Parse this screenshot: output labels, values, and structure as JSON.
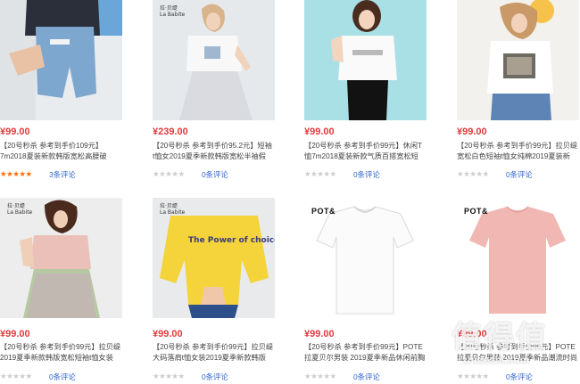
{
  "products": [
    {
      "price": "¥99.00",
      "title1": "【20号秒杀 参考到手价109元】",
      "title2": "7m2018夏装新款韩版宽松高腰破",
      "reviews": "3条评论",
      "stars": 5
    },
    {
      "price": "¥239.00",
      "title1": "【20号秒杀 参考到手价95.2元】短袖",
      "title2": "t恤女2019夏季新款韩版宽松半袖假",
      "reviews": "0条评论",
      "stars": 0
    },
    {
      "price": "¥99.00",
      "title1": "【20号秒杀 参考到手价99元】休闲T",
      "title2": "恤7m2018夏装新款气质百搭宽松短",
      "reviews": "0条评论",
      "stars": 0
    },
    {
      "price": "¥99.00",
      "title1": "【20号秒杀 参考到手价99元】拉贝缇",
      "title2": "宽松白色短袖t恤女纯棉2019夏装新",
      "reviews": "0条评论",
      "stars": 0
    },
    {
      "price": "¥99.00",
      "title1": "【20号秒杀 参考到手价99元】拉贝缇",
      "title2": "2019夏季新款韩版宽松短袖t恤女装",
      "reviews": "0条评论",
      "stars": 0
    },
    {
      "price": "¥99.00",
      "title1": "【20号秒杀 参考到手价99元】拉贝缇",
      "title2": "大码落肩t恤女装2019夏季新款韩版",
      "reviews": "0条评论",
      "stars": 0
    },
    {
      "price": "¥99.00",
      "title1": "【20号秒杀 参考到手价99元】POTE",
      "title2": "拉夏贝尔男装 2019夏季新品休闲前胸",
      "reviews": "0条评论",
      "stars": 0
    },
    {
      "price": "¥99.00",
      "title1": "【20号秒杀 参考到手价99元】POTE",
      "title2": "拉夏贝尔男装 2019夏季新品潮流时尚",
      "reviews": "0条评论",
      "stars": 0
    }
  ],
  "brands": {
    "labei": "拉·贝缇",
    "labei_sub": "La Babite",
    "pote": "POT&"
  },
  "thumb_text": {
    "yellow_shirt": "The Power of choice."
  },
  "watermark": {
    "main": "值得值",
    "sub": "zhidezhi.com"
  },
  "colors": {
    "price": "#e4393c",
    "link": "#3366cc",
    "star_on": "#ff6a00",
    "star_off": "#cccccc"
  }
}
